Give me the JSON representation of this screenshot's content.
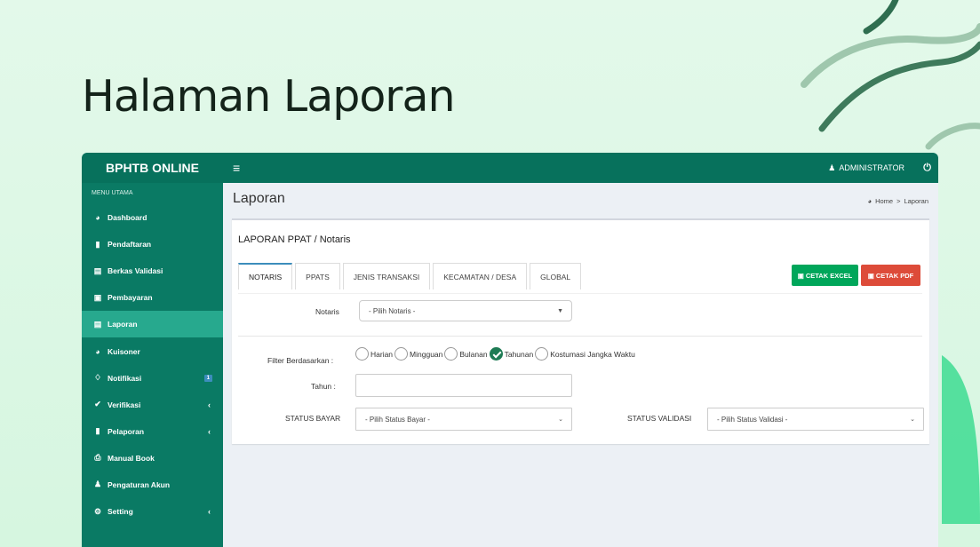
{
  "slide": {
    "title": "Halaman Laporan"
  },
  "app": {
    "brand": "BPHTB ONLINE",
    "hamburger": "≡",
    "user": "ADMINISTRATOR",
    "power_icon": "⏻"
  },
  "sidebar": {
    "header": "MENU UTAMA",
    "items": [
      {
        "label": "Dashboard",
        "icon": "dashboard-icon",
        "glyph": "◕"
      },
      {
        "label": "Pendaftaran",
        "icon": "book-icon",
        "glyph": "▮"
      },
      {
        "label": "Berkas Validasi",
        "icon": "file-icon",
        "glyph": "▤"
      },
      {
        "label": "Pembayaran",
        "icon": "money-icon",
        "glyph": "▣"
      },
      {
        "label": "Laporan",
        "icon": "report-icon",
        "glyph": "▤"
      },
      {
        "label": "Kuisoner",
        "icon": "pie-icon",
        "glyph": "◕"
      },
      {
        "label": "Notifikasi",
        "icon": "bell-icon",
        "glyph": "♢",
        "badge": "1"
      },
      {
        "label": "Verifikasi",
        "icon": "check-icon",
        "glyph": "✔",
        "chevron": "‹"
      },
      {
        "label": "Pelaporan",
        "icon": "book-icon",
        "glyph": "▮",
        "chevron": "‹"
      },
      {
        "label": "Manual Book",
        "icon": "print-icon",
        "glyph": "⎙"
      },
      {
        "label": "Pengaturan Akun",
        "icon": "user-icon",
        "glyph": "♟"
      },
      {
        "label": "Setting",
        "icon": "gear-icon",
        "glyph": "⚙",
        "chevron": "‹"
      }
    ]
  },
  "content": {
    "title": "Laporan",
    "breadcrumb": {
      "home": "Home",
      "separator": ">",
      "current": "Laporan"
    },
    "box_title": "LAPORAN PPAT / Notaris",
    "tabs": [
      "NOTARIS",
      "PPATS",
      "JENIS TRANSAKSI",
      "KECAMATAN / DESA",
      "GLOBAL"
    ],
    "btn_excel": "CETAK EXCEL",
    "btn_pdf": "CETAK PDF",
    "notaris_label": "Notaris",
    "notaris_select": "- Pilih Notaris -",
    "filter_label": "Filter Berdasarkan :",
    "filter_options": [
      "Harian",
      "Mingguan",
      "Bulanan",
      "Tahunan",
      "Kostumasi Jangka Waktu"
    ],
    "filter_selected": "Tahunan",
    "tahun_label": "Tahun :",
    "tahun_value": "",
    "status_bayar_label": "STATUS BAYAR",
    "status_bayar_select": "- Pilih Status Bayar -",
    "status_validasi_label": "STATUS VALIDASI",
    "status_validasi_select": "- Pilih Status Validasi -"
  },
  "colors": {
    "primary": "#07715c",
    "sidebar": "#0a7a64",
    "active": "#27a98e",
    "excel": "#00a65a",
    "pdf": "#dd4b39"
  }
}
